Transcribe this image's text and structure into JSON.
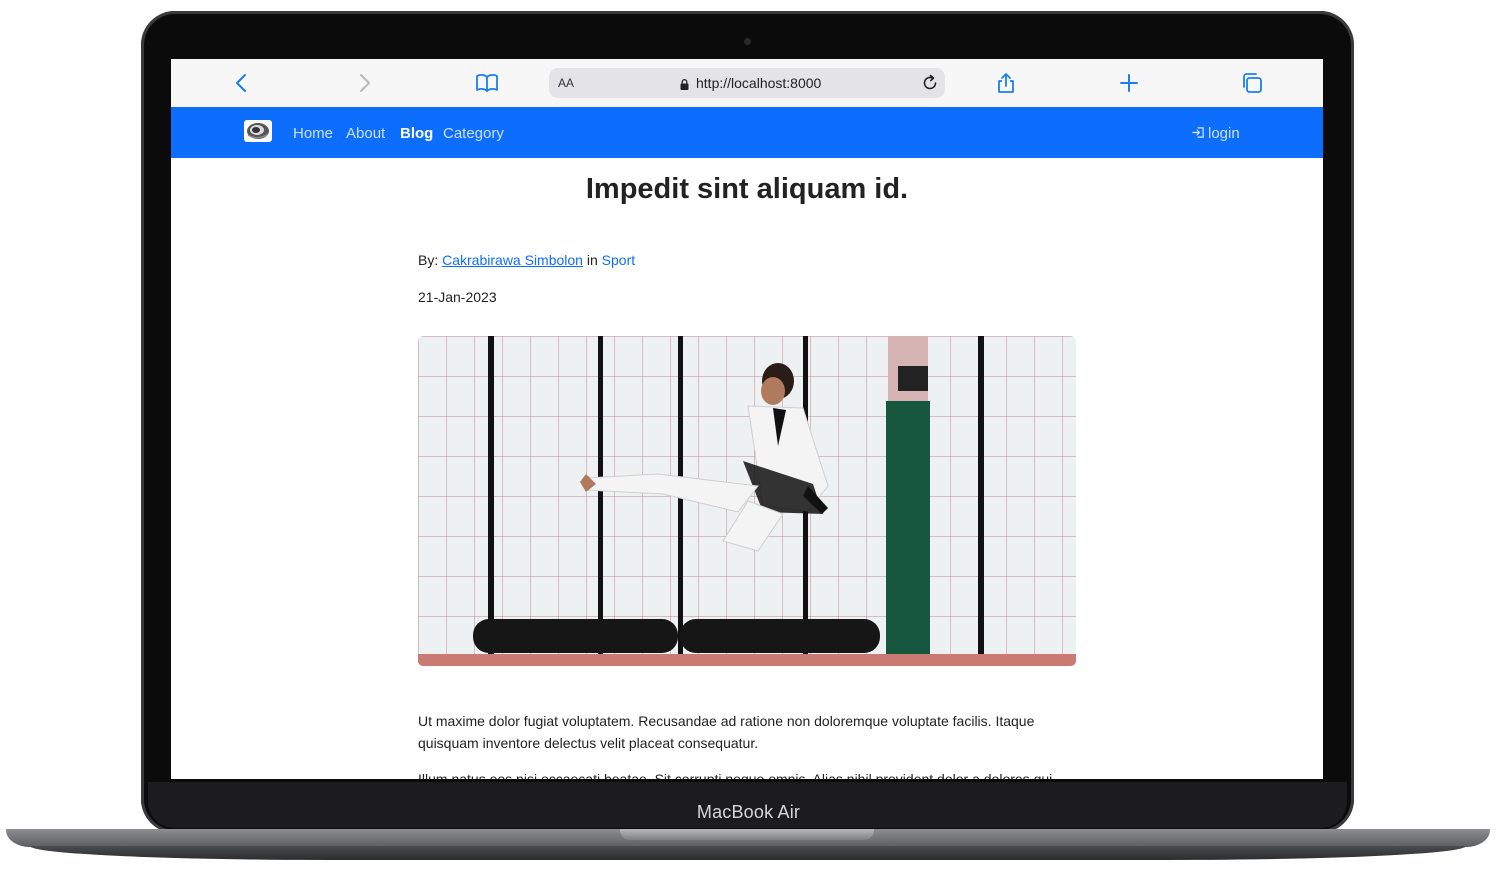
{
  "device": {
    "brand_label": "MacBook Air"
  },
  "browser": {
    "text_size_label": "AA",
    "url": "http://localhost:8000",
    "accent_color": "#1a7ff0"
  },
  "navbar": {
    "background": "#0d6efd",
    "links": [
      {
        "label": "Home"
      },
      {
        "label": "About"
      },
      {
        "label": "Blog",
        "active": true
      },
      {
        "label": "Category"
      }
    ],
    "login_label": "login"
  },
  "post": {
    "title": "Impedit sint aliquam id.",
    "by_prefix": "By:",
    "author": "Cakrabirawa Simbolon",
    "in_word": "in",
    "category": "Sport",
    "date": "21-Jan-2023",
    "paragraphs": [
      "Ut maxime dolor fugiat voluptatem. Recusandae ad ratione non doloremque voluptate facilis. Itaque quisquam inventore delectus velit placeat consequatur.",
      "Illum natus eos nisi occaecati beatae. Sit corrupti neque omnis. Alias nihil provident dolor a dolores qui."
    ]
  }
}
